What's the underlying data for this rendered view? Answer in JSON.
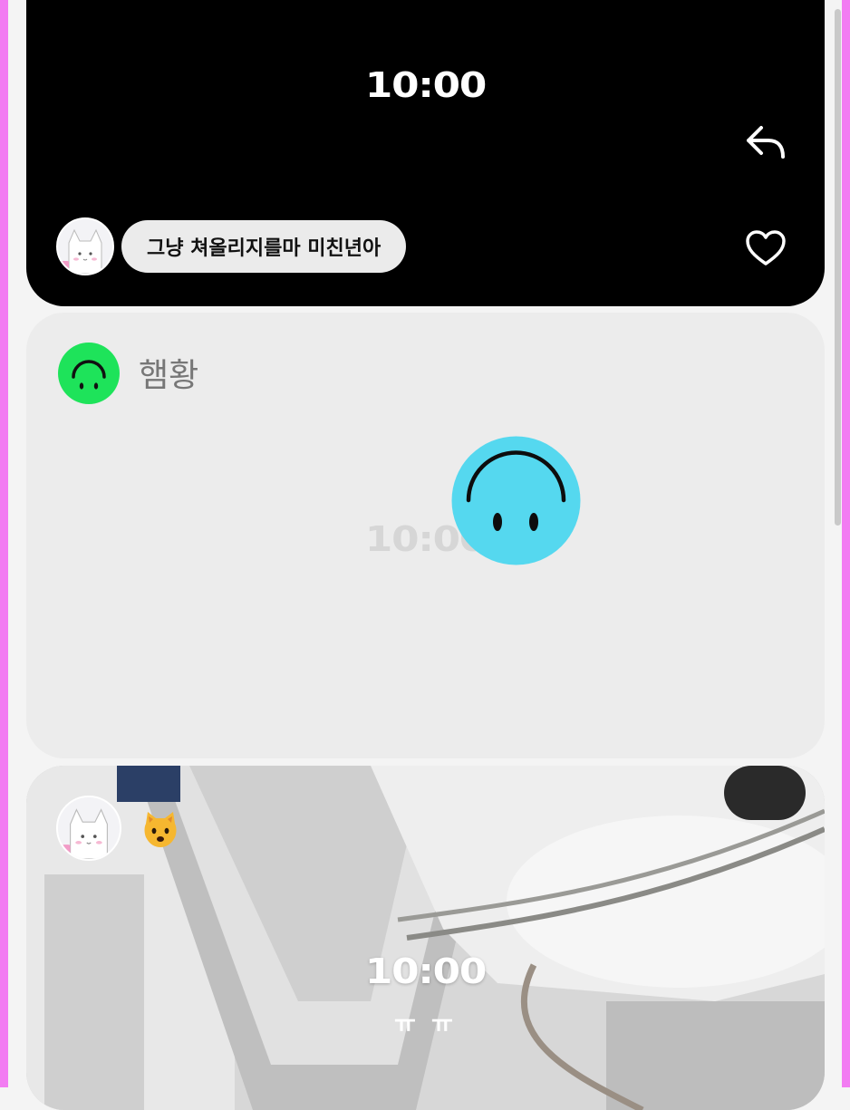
{
  "colors": {
    "accent_border": "#f27cf2",
    "green_avatar": "#1ee35a",
    "cyan_sticker": "#55d8ef"
  },
  "post1": {
    "time": "10:00",
    "message": "그냥 쳐올리지를마 미친년아",
    "icons": {
      "reply": "reply-arrow-icon",
      "like": "heart-outline-icon"
    }
  },
  "post2": {
    "username": "햄황",
    "time": "10:00",
    "icons": {
      "avatar": "upside-down-smiley-icon",
      "sticker": "upside-down-smiley-icon"
    }
  },
  "post3": {
    "time": "10:00",
    "caption": "ㅠ ㅠ",
    "emoji": "cat-face-emoji"
  }
}
